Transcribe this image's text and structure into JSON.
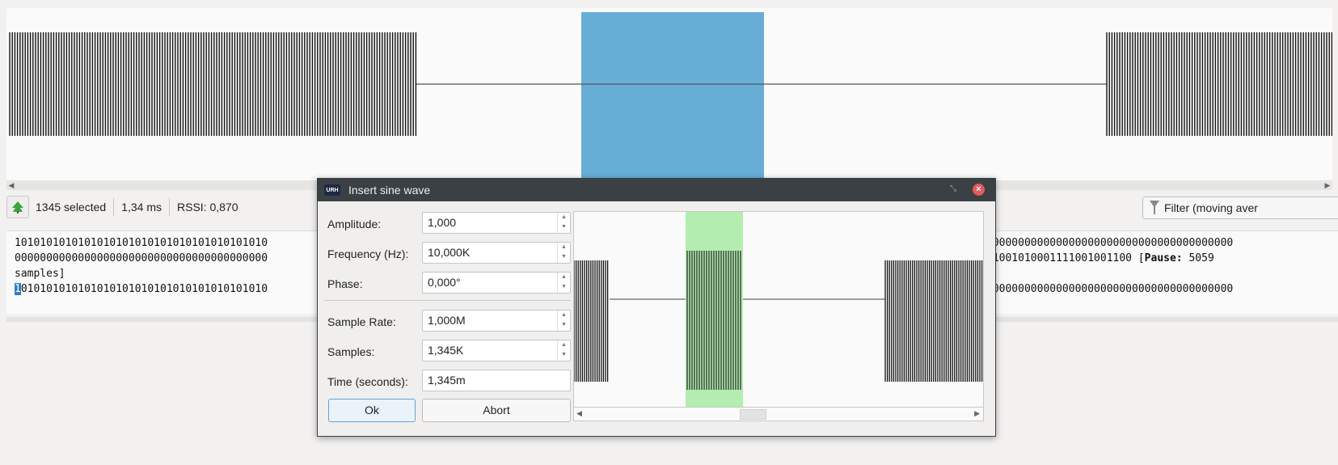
{
  "status": {
    "selected": "1345 selected",
    "duration": "1,34 ms",
    "rssi": "RSSI: 0,870"
  },
  "filter_button": {
    "label": "Filter (moving aver"
  },
  "bits": {
    "line1_left": "1010101010101010101010101010101010101010",
    "line1_right": "000000000000000000000000000000000000000",
    "line2_left": "0000000000000000000000000000000000000000",
    "line2_right_prefix": "11001010001111001001100 [",
    "pause_label": "Pause:",
    "line2_right_suffix": " 5059",
    "line3": "samples]",
    "line4_cursor": "1",
    "line4_left": "010101010101010101010101010101010101010",
    "line4_right": "000000000000000000000000000000000000000"
  },
  "dialog": {
    "app_icon_text": "URH",
    "title": "Insert sine wave",
    "fields": {
      "amplitude": {
        "label": "Amplitude:",
        "value": "1,000"
      },
      "frequency": {
        "label": "Frequency (Hz):",
        "value": "10,000K"
      },
      "phase": {
        "label": "Phase:",
        "value": "0,000°"
      },
      "sample_rate": {
        "label": "Sample Rate:",
        "value": "1,000M"
      },
      "samples": {
        "label": "Samples:",
        "value": "1,345K"
      },
      "time": {
        "label": "Time (seconds):",
        "value": "1,345m"
      }
    },
    "ok_label": "Ok",
    "abort_label": "Abort"
  },
  "colors": {
    "selection": "#67aed6",
    "preview_insert": "#b3eeb0",
    "dialog_titlebar": "#3b4045",
    "close_button": "#e45b5b",
    "cursor_highlight": "#2f7fc4"
  },
  "icons": {
    "status_toggle": "green-tree-icon",
    "filter": "funnel-icon",
    "close": "close-icon"
  }
}
